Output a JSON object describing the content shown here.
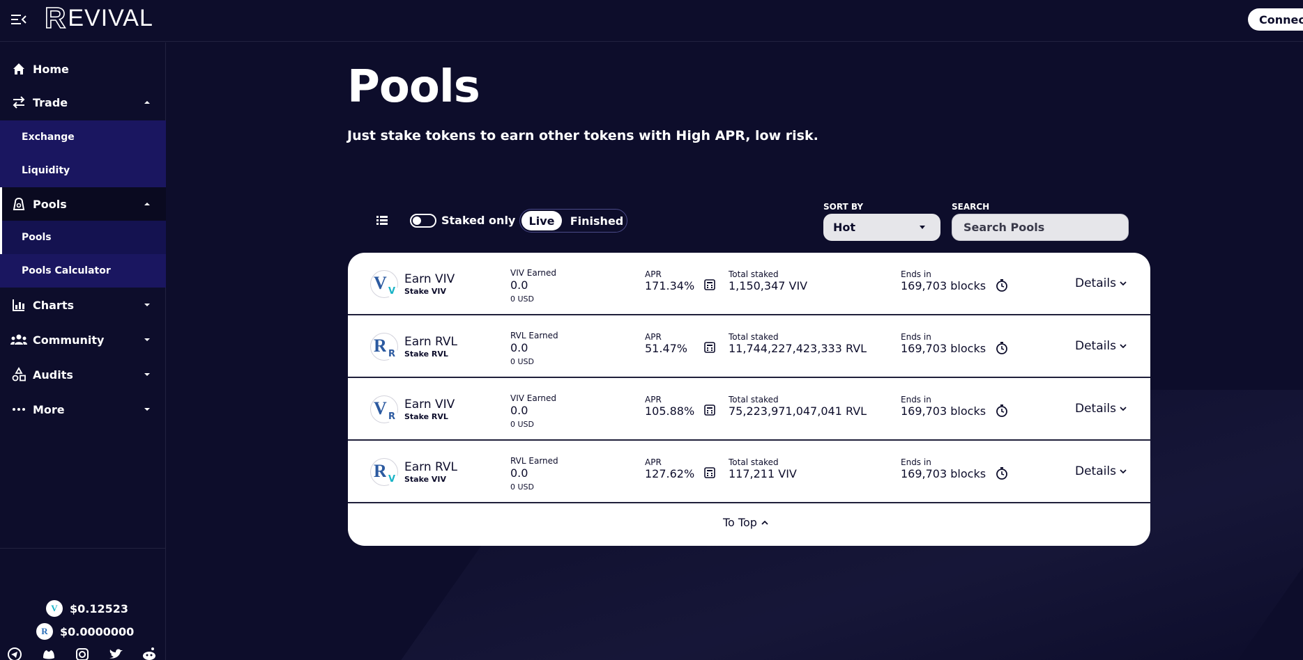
{
  "app": {
    "logo_text": "EVIVAL",
    "logo_initial": "R"
  },
  "header": {
    "connect_label": "Connect"
  },
  "sidebar": {
    "nav": {
      "home": "Home",
      "trade": "Trade",
      "exchange": "Exchange",
      "liquidity": "Liquidity",
      "pools": "Pools",
      "pools_sub": "Pools",
      "pools_calculator": "Pools Calculator",
      "charts": "Charts",
      "community": "Community",
      "audits": "Audits",
      "more": "More"
    },
    "prices": {
      "viv": "$0.12523",
      "rvl": "$0.0000000"
    },
    "social_icons": [
      "telegram-icon",
      "discord-icon",
      "instagram-icon",
      "twitter-icon",
      "reddit-icon"
    ]
  },
  "main": {
    "title": "Pools",
    "subtitle": "Just stake tokens to earn other tokens with High APR, low risk.",
    "controls": {
      "staked_only": "Staked only",
      "live": "Live",
      "finished": "Finished",
      "sort_label": "SORT BY",
      "sort_value": "Hot",
      "search_label": "SEARCH",
      "search_placeholder": "Search Pools"
    },
    "labels": {
      "apr": "APR",
      "total_staked": "Total staked",
      "ends_in": "Ends in",
      "details": "Details",
      "to_top": "To Top"
    },
    "pools": [
      {
        "earn": "Earn VIV",
        "stake": "Stake VIV",
        "earned_label": "VIV Earned",
        "earned": "0.0",
        "earned_usd": "0 USD",
        "apr": "171.34%",
        "total_staked": "1,150,347 VIV",
        "ends_in": "169,703 blocks"
      },
      {
        "earn": "Earn RVL",
        "stake": "Stake RVL",
        "earned_label": "RVL Earned",
        "earned": "0.0",
        "earned_usd": "0 USD",
        "apr": "51.47%",
        "total_staked": "11,744,227,423,333 RVL",
        "ends_in": "169,703 blocks"
      },
      {
        "earn": "Earn VIV",
        "stake": "Stake RVL",
        "earned_label": "VIV Earned",
        "earned": "0.0",
        "earned_usd": "0 USD",
        "apr": "105.88%",
        "total_staked": "75,223,971,047,041 RVL",
        "ends_in": "169,703 blocks"
      },
      {
        "earn": "Earn RVL",
        "stake": "Stake VIV",
        "earned_label": "RVL Earned",
        "earned": "0.0",
        "earned_usd": "0 USD",
        "apr": "127.62%",
        "total_staked": "117,211 VIV",
        "ends_in": "169,703 blocks"
      }
    ]
  },
  "colors": {
    "background": "#0d0d2b",
    "submenu": "#1a1660",
    "card": "#ffffff",
    "viv": "#19b3c6",
    "rvl": "#2c5aa0"
  }
}
